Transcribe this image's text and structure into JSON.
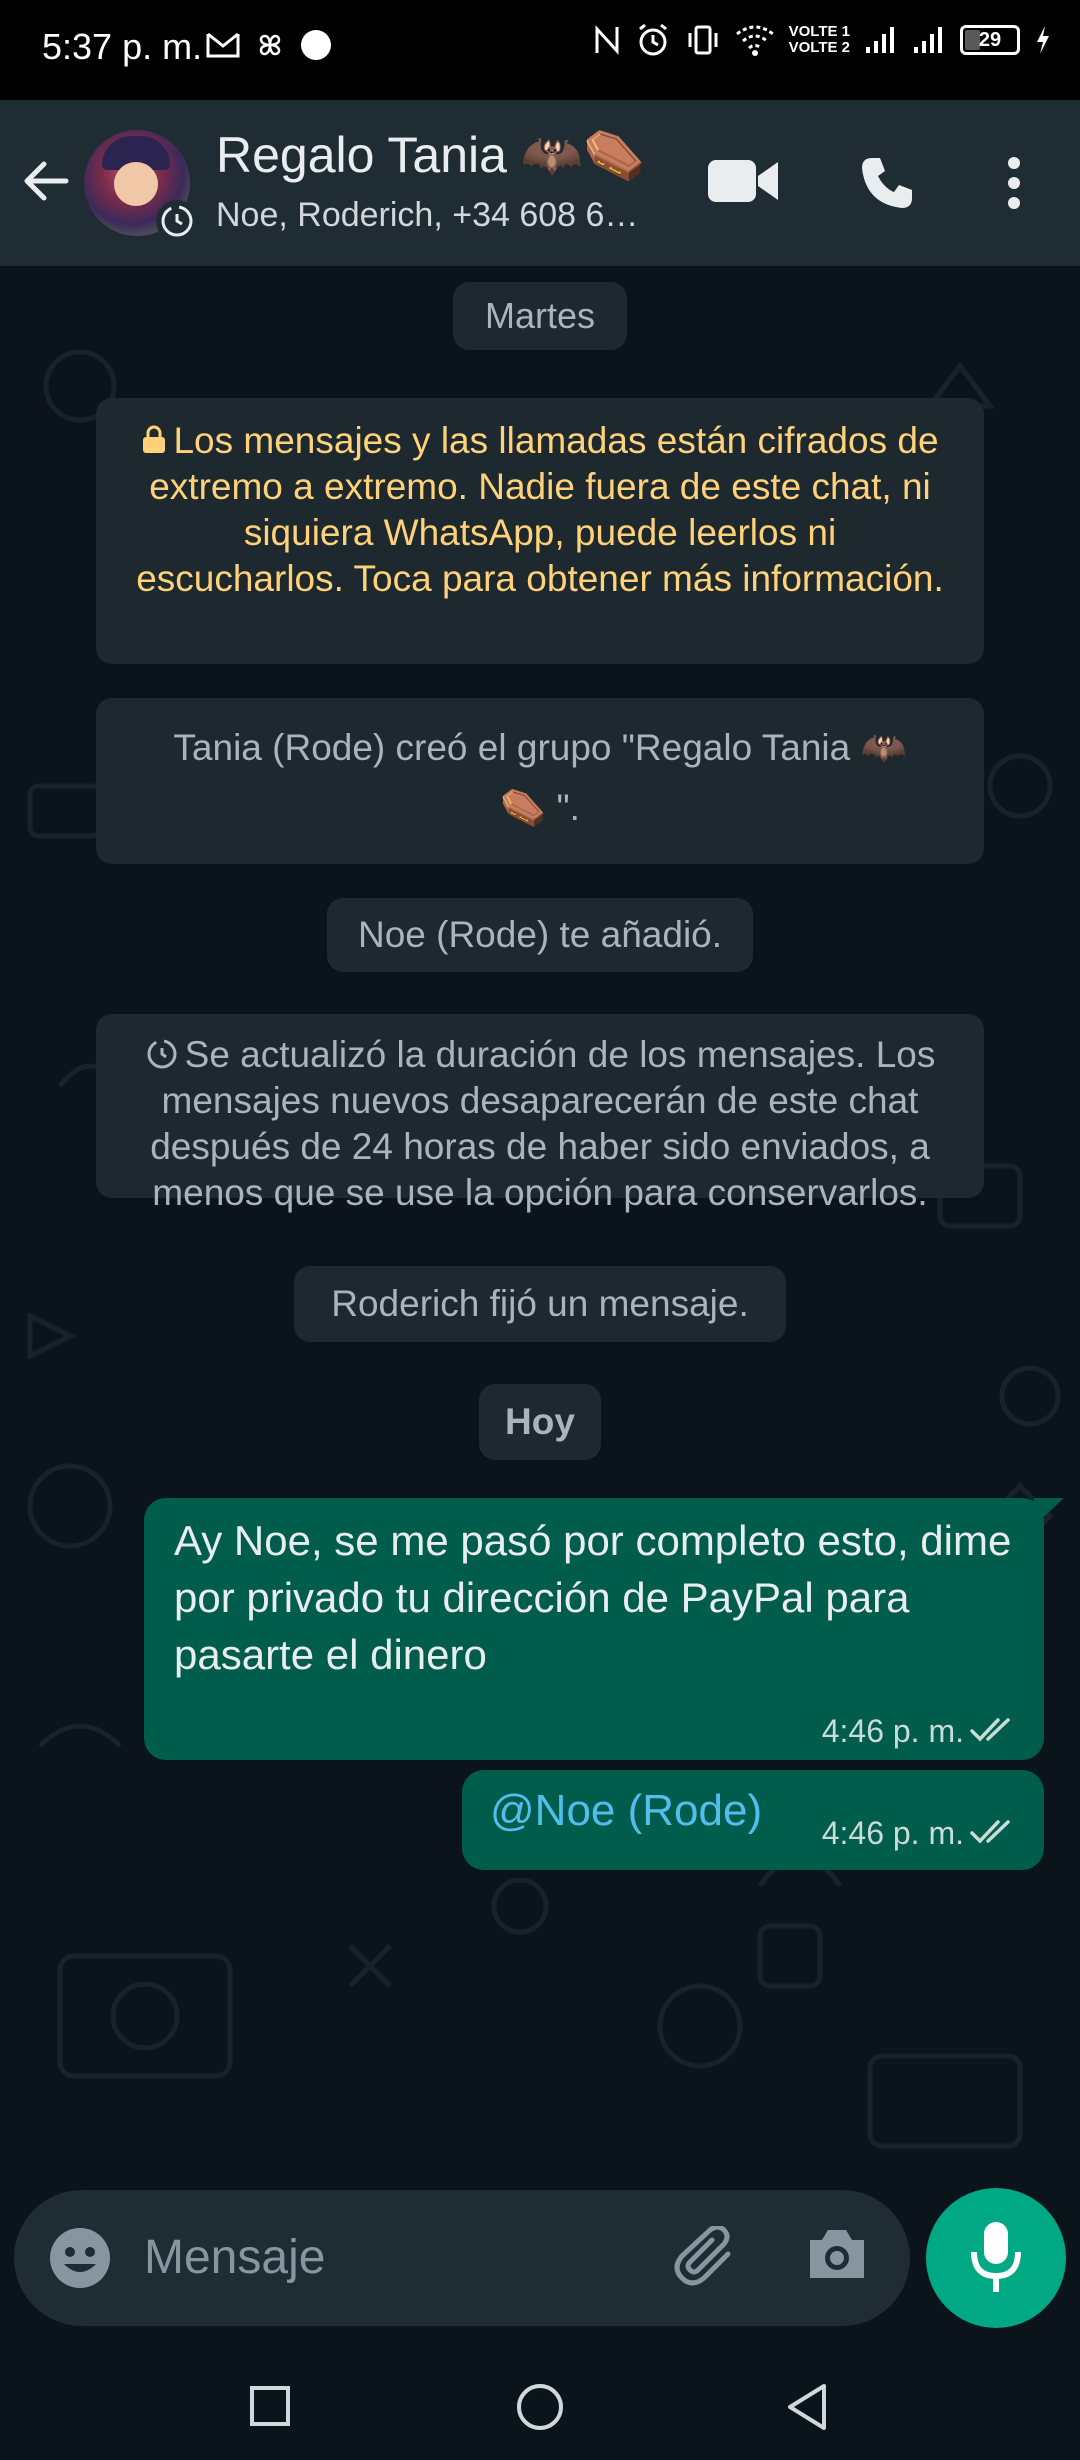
{
  "status_bar": {
    "time": "5:37 p. m.",
    "volte1": "VOLTE 1",
    "volte2": "VOLTE 2",
    "battery": "29",
    "battery_level": 0.29
  },
  "header": {
    "title": "Regalo Tania 🦇⚰️",
    "subtitle": "Noe, Roderich, +34 608 6…",
    "icons": [
      "back-arrow-icon",
      "video-call-icon",
      "voice-call-icon",
      "more-vert-icon"
    ]
  },
  "chat": {
    "date_tuesday": "Martes",
    "encryption_notice": "Los mensajes y las llamadas están cifrados de extremo a extremo. Nadie fuera de este chat, ni siquiera WhatsApp, puede leerlos ni escucharlos. Toca para obtener más información.",
    "group_created_line1": "Tania (Rode) creó el grupo \"Regalo Tania 🦇",
    "group_created_line2": "⚰️ \".",
    "added_notice": "Noe (Rode) te añadió.",
    "disappearing_notice": "Se actualizó la duración de los mensajes. Los mensajes nuevos desaparecerán de este chat después de 24 horas de haber sido enviados, a menos que se use la opción para conservarlos.",
    "pinned_notice": "Roderich fijó un mensaje.",
    "date_today": "Hoy",
    "messages": [
      {
        "text": "Ay Noe, se me pasó por completo esto, dime por privado tu dirección de PayPal para pasarte el dinero",
        "time": "4:46 p. m."
      },
      {
        "text": "@Noe (Rode)",
        "time": "4:46 p. m."
      }
    ]
  },
  "input": {
    "placeholder": "Mensaje"
  },
  "colors": {
    "header_bg": "#1f2c34",
    "chat_bg": "#0b141a",
    "outgoing_bubble": "#005c4b",
    "accent": "#00a884",
    "encryption_text": "#ffd279",
    "mention": "#53bdeb"
  }
}
